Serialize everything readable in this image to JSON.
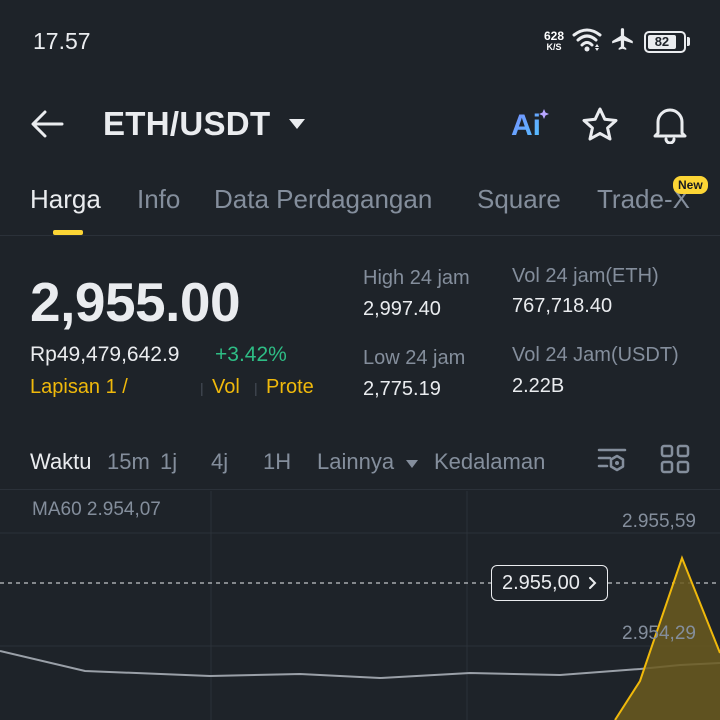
{
  "status": {
    "time": "17.57",
    "net_speed_value": "628",
    "net_speed_unit": "K/S",
    "battery": "82"
  },
  "header": {
    "pair": "ETH/USDT",
    "ai_label": "Ai"
  },
  "tabs": [
    {
      "label": "Harga",
      "active": true
    },
    {
      "label": "Info"
    },
    {
      "label": "Data Perdagangan"
    },
    {
      "label": "Square"
    },
    {
      "label": "Trade-X",
      "badge": "New"
    }
  ],
  "price": {
    "last": "2,955.00",
    "fiat": "Rp49,479,642.9",
    "change": "+3.42%",
    "layer": "Lapisan 1 /",
    "tag_vol": "Vol",
    "tag_prote": "Prote"
  },
  "stats": {
    "high_label": "High 24 jam",
    "high_value": "2,997.40",
    "low_label": "Low 24 jam",
    "low_value": "2,775.19",
    "vol_eth_label": "Vol 24 jam(ETH)",
    "vol_eth_value": "767,718.40",
    "vol_usdt_label": "Vol 24 Jam(USDT)",
    "vol_usdt_value": "2.22B"
  },
  "toolbar": {
    "time_label": "Waktu",
    "intervals": [
      "15m",
      "1j",
      "4j",
      "1H"
    ],
    "more_label": "Lainnya",
    "depth_label": "Kedalaman"
  },
  "chart": {
    "ma_label": "MA60 2.954,07",
    "axis_top": "2.955,59",
    "axis_mid": "2.954,29",
    "current_price_tag": "2.955,00"
  },
  "colors": {
    "background": "#1e2329",
    "accent": "#fcd535",
    "up": "#2ebd85",
    "muted": "#848e9c"
  }
}
